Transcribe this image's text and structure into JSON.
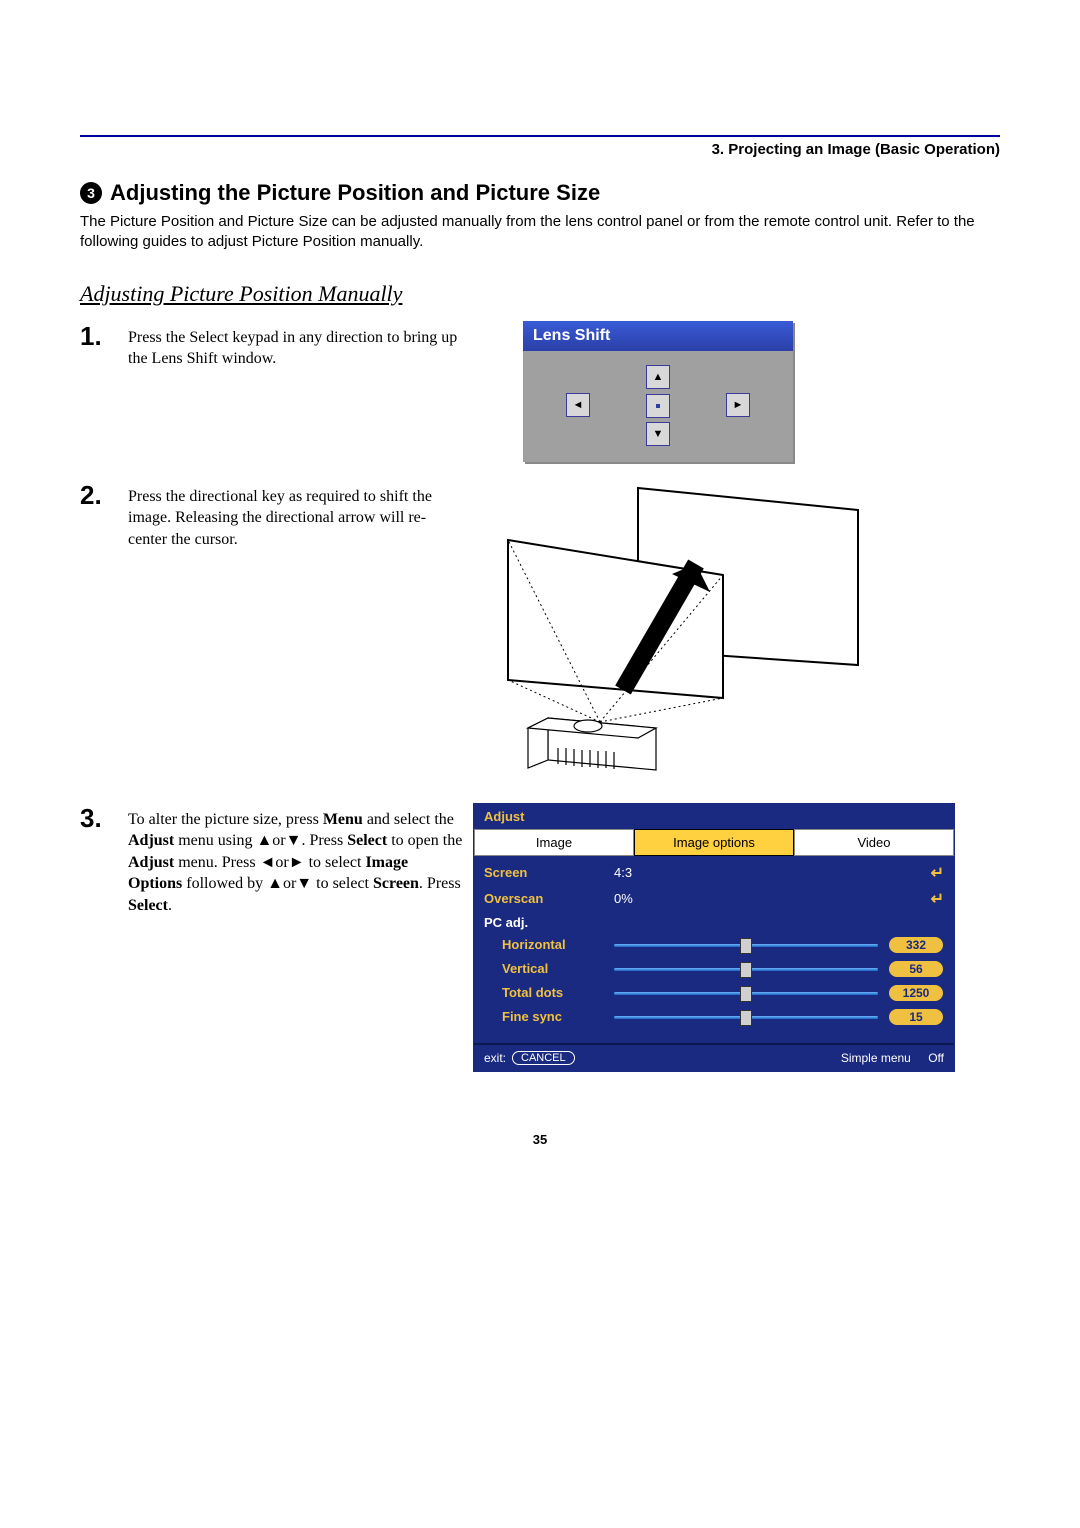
{
  "header": {
    "chapter": "3. Projecting an Image (Basic Operation)"
  },
  "section": {
    "number": "3",
    "title": "Adjusting the Picture Position and Picture Size"
  },
  "intro": "The Picture Position and Picture Size can be adjusted manually from the lens control panel or from the remote control unit. Refer to the following guides to adjust Picture Position manually.",
  "subheading": "Adjusting Picture Position Manually",
  "steps": {
    "s1": {
      "num": "1.",
      "text": "Press the Select keypad in any direction to bring up the Lens Shift window."
    },
    "s2": {
      "num": "2.",
      "text": "Press the directional key as required to shift the image. Releasing the directional arrow will re-center the cursor."
    },
    "s3": {
      "num": "3.",
      "text_a": "To alter the picture size, press ",
      "menu": "Menu",
      "text_b": " and select the ",
      "adjust1": "Adjust",
      "text_c": " menu using ▲or▼. Press ",
      "select1": "Select",
      "text_d": " to open the ",
      "adjust2": "Adjust",
      "text_e": " menu. Press ◄or► to select ",
      "imgopt": "Image Options",
      "text_f": " followed by ▲or▼ to select ",
      "screen": "Screen",
      "text_g": ". Press ",
      "select2": "Select",
      "text_h": "."
    }
  },
  "lens_shift": {
    "title": "Lens Shift"
  },
  "osd": {
    "title": "Adjust",
    "tabs": {
      "t1": "Image",
      "t2": "Image options",
      "t3": "Video"
    },
    "rows": {
      "screen": {
        "label": "Screen",
        "value": "4:3"
      },
      "overscan": {
        "label": "Overscan",
        "value": "0%"
      },
      "pcadj": {
        "label": "PC adj."
      },
      "horiz": {
        "label": "Horizontal",
        "value": "332",
        "pos": 50
      },
      "vert": {
        "label": "Vertical",
        "value": "56",
        "pos": 50
      },
      "tdots": {
        "label": "Total dots",
        "value": "1250",
        "pos": 50
      },
      "fsync": {
        "label": "Fine sync",
        "value": "15",
        "pos": 50
      }
    },
    "footer": {
      "exit": "exit:",
      "cancel": "CANCEL",
      "simple": "Simple menu",
      "off": "Off"
    }
  },
  "page_number": "35"
}
